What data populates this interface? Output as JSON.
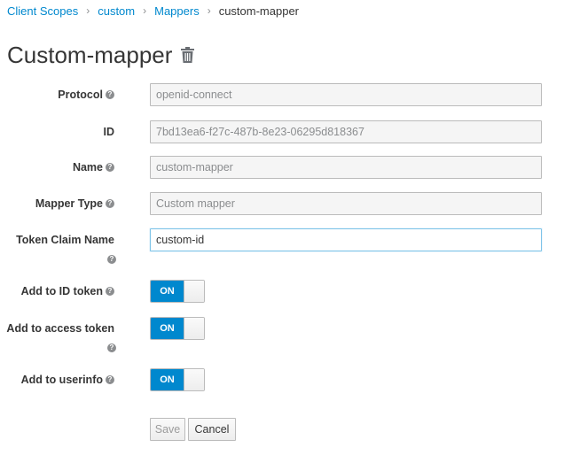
{
  "breadcrumb": {
    "items": [
      "Client Scopes",
      "custom",
      "Mappers"
    ],
    "current": "custom-mapper",
    "separator": "›"
  },
  "header": {
    "title": "Custom-mapper",
    "delete_icon": "trash-icon"
  },
  "form": {
    "protocol": {
      "label": "Protocol",
      "value": "openid-connect",
      "help_icon": "question-circle-icon"
    },
    "id": {
      "label": "ID",
      "value": "7bd13ea6-f27c-487b-8e23-06295d818367"
    },
    "name": {
      "label": "Name",
      "value": "custom-mapper",
      "help_icon": "question-circle-icon"
    },
    "mapper_type": {
      "label": "Mapper Type",
      "value": "Custom mapper",
      "help_icon": "question-circle-icon"
    },
    "token_claim_name": {
      "label": "Token Claim Name",
      "value": "custom-id",
      "help_icon": "question-circle-icon"
    },
    "add_to_id_token": {
      "label": "Add to ID token",
      "state": "ON",
      "help_icon": "question-circle-icon"
    },
    "add_to_access_token": {
      "label": "Add to access token",
      "state": "ON",
      "help_icon": "question-circle-icon"
    },
    "add_to_userinfo": {
      "label": "Add to userinfo",
      "state": "ON",
      "help_icon": "question-circle-icon"
    }
  },
  "actions": {
    "save_label": "Save",
    "cancel_label": "Cancel"
  },
  "colors": {
    "link": "#0088ce",
    "toggle_on": "#0088ce",
    "text": "#363636",
    "muted": "#8b8d8f"
  }
}
